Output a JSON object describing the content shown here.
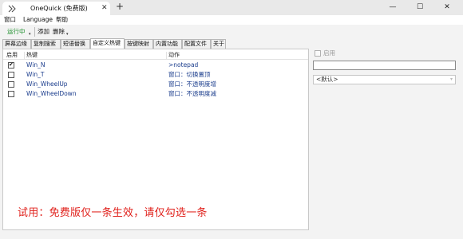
{
  "window": {
    "tab_title": "OneQuick (免费版)",
    "tab_close": "✕",
    "tab_add": "+",
    "min": "—",
    "max": "☐",
    "close": "✕"
  },
  "menu": [
    "窗口",
    "Language",
    "帮助"
  ],
  "toolbar": {
    "running_label": "运行中",
    "add_label": "添加",
    "delete_label": "删除",
    "caret": "▾"
  },
  "tabs": [
    "屏幕边缘",
    "复制搜索",
    "短语替换",
    "自定义热键",
    "按键映射",
    "内置功能",
    "配置文件",
    "关于"
  ],
  "active_tab": 3,
  "table": {
    "headers": [
      "启用",
      "热键",
      "动作"
    ],
    "rows": [
      {
        "enabled": true,
        "check": "✔",
        "hotkey": "Win_N",
        "action": ">notepad"
      },
      {
        "enabled": false,
        "check": "",
        "hotkey": "Win_T",
        "action": "窗口：切换置顶"
      },
      {
        "enabled": false,
        "check": "",
        "hotkey": "Win_WheelUp",
        "action": "窗口：不透明度增"
      },
      {
        "enabled": false,
        "check": "",
        "hotkey": "Win_WheelDown",
        "action": "窗口：不透明度减"
      }
    ]
  },
  "trial_notice": "试用：免费版仅一条生效，请仅勾选一条",
  "right_panel": {
    "enable_label": "启用",
    "name_value": "",
    "default_option": "<默认>",
    "select_caret": "▾"
  },
  "colors": {
    "running": "#1d8f2b",
    "trial": "#e0201b",
    "link_text": "#1a3c8c"
  }
}
